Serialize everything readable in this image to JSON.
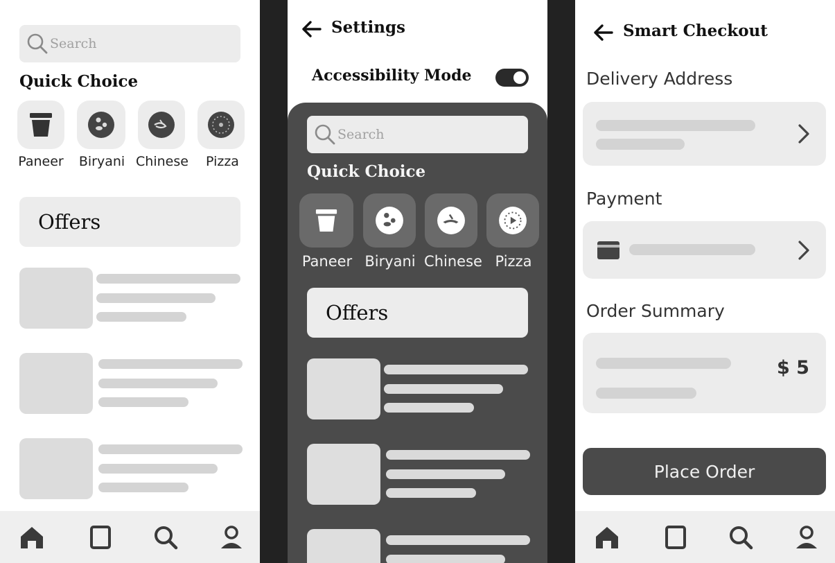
{
  "home": {
    "search": {
      "placeholder": "Search",
      "icon": "search-icon"
    },
    "quick_choice": {
      "title": "Quick Choice",
      "items": [
        {
          "label": "Paneer",
          "icon": "cup-icon"
        },
        {
          "label": "Biryani",
          "icon": "rice-bowl-icon"
        },
        {
          "label": "Chinese",
          "icon": "noodle-bowl-icon"
        },
        {
          "label": "Pizza",
          "icon": "pizza-icon"
        }
      ]
    },
    "offers": {
      "label": "Offers"
    },
    "bottom_nav": [
      "home-icon",
      "orders-icon",
      "search-icon",
      "profile-icon"
    ]
  },
  "settings": {
    "title": "Settings",
    "accessibility": {
      "label": "Accessibility Mode",
      "enabled": true
    },
    "search": {
      "placeholder": "Search"
    },
    "quick_choice": {
      "title": "Quick Choice",
      "items": [
        {
          "label": "Paneer",
          "icon": "cup-icon"
        },
        {
          "label": "Biryani",
          "icon": "rice-bowl-icon"
        },
        {
          "label": "Chinese",
          "icon": "noodle-bowl-icon"
        },
        {
          "label": "Pizza",
          "icon": "pizza-icon"
        }
      ]
    },
    "offers": {
      "label": "Offers"
    }
  },
  "checkout": {
    "title": "Smart Checkout",
    "delivery_address": {
      "title": "Delivery Address"
    },
    "payment": {
      "title": "Payment",
      "icon": "card-icon"
    },
    "order_summary": {
      "title": "Order Summary",
      "total": "$ 5"
    },
    "place_order": {
      "label": "Place Order"
    },
    "bottom_nav": [
      "home-icon",
      "orders-icon",
      "search-icon",
      "profile-icon"
    ]
  },
  "colors": {
    "accent_dark": "#4a4a4a",
    "background": "#ffffff",
    "divider": "#222222"
  }
}
